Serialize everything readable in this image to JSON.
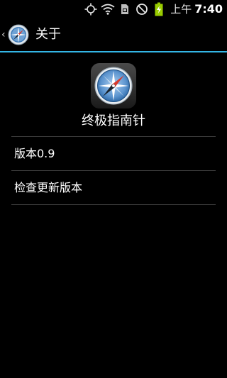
{
  "status_bar": {
    "ampm": "上午",
    "time": "7:40",
    "icons": [
      "gps-icon",
      "wifi-icon",
      "sim-icon",
      "do-not-disturb-icon",
      "battery-charging-icon"
    ]
  },
  "action_bar": {
    "title": "关于",
    "up_caret": "‹"
  },
  "about": {
    "app_name": "终极指南针"
  },
  "list": {
    "version": "版本0.9",
    "check_update": "检查更新版本"
  },
  "colors": {
    "accent": "#33b5e5",
    "divider": "#3a3a3a",
    "background": "#000000"
  }
}
